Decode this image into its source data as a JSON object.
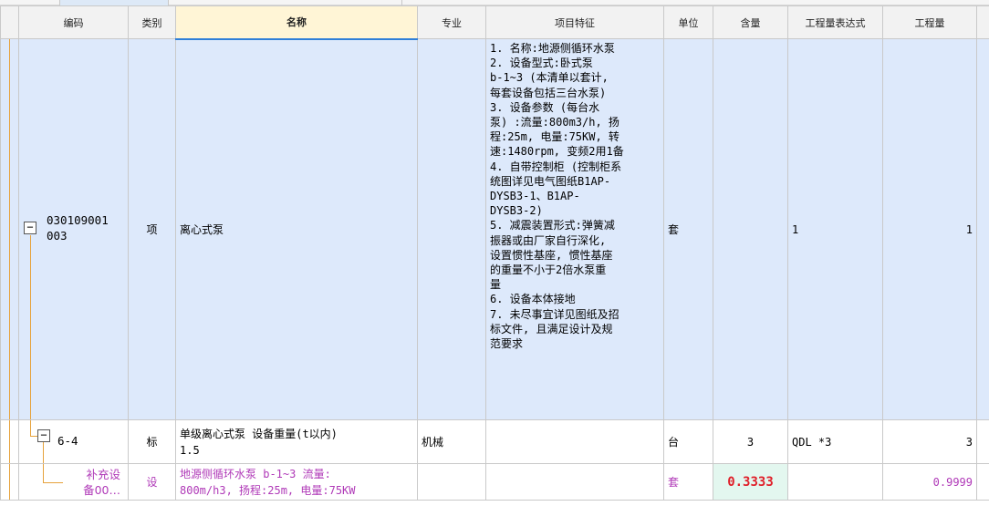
{
  "colors": {
    "header_bg": "#f2f2f2",
    "active_header_bg": "#fff5d6",
    "active_header_border": "#2f7fd8",
    "item_row_bg": "#dde9fb",
    "supplement_text": "#b03ab8",
    "quantity_highlight_bg": "#e3f7ef",
    "quantity_highlight_text": "#e0202a",
    "tree_line": "#e6a23c"
  },
  "columns": {
    "code": "编码",
    "category": "类别",
    "name": "名称",
    "specialty": "专业",
    "features": "项目特征",
    "unit": "单位",
    "content": "含量",
    "expression": "工程量表达式",
    "quantity": "工程量"
  },
  "rows": [
    {
      "code": "030109001003",
      "code_display": "030109001\n003",
      "toggle": "−",
      "category": "项",
      "name": "离心式泵",
      "specialty": "",
      "features": [
        "1. 名称:地源侧循环水泵",
        "2. 设备型式:卧式泵",
        "b-1~3 (本清单以套计,",
        "每套设备包括三台水泵)",
        "3. 设备参数 (每台水",
        "泵) :流量:800m3/h, 扬",
        "程:25m, 电量:75KW, 转",
        "速:1480rpm, 变频2用1备",
        "4. 自带控制柜 (控制柜系",
        "统图详见电气图纸B1AP-",
        "DYSB3-1、B1AP-",
        "DYSB3-2)",
        "5. 减震装置形式:弹簧减",
        "振器或由厂家自行深化,",
        "设置惯性基座, 惯性基座",
        "的重量不小于2倍水泵重",
        "量",
        "6. 设备本体接地",
        "7. 未尽事宜详见图纸及招",
        "标文件, 且满足设计及规",
        "范要求"
      ],
      "unit": "套",
      "content": "",
      "expression": "1",
      "quantity": "1"
    },
    {
      "code": "6-4",
      "toggle": "−",
      "category": "标",
      "name_line1": "单级离心式泵 设备重量(t以内)",
      "name_line2": "1.5",
      "specialty": "机械",
      "features": "",
      "unit": "台",
      "content": "3",
      "expression": "QDL *3",
      "quantity": "3"
    },
    {
      "code_line1": "补充设",
      "code_line2": "备00…",
      "category": "设",
      "name_line1": "地源侧循环水泵 b-1~3 流量:",
      "name_line2": "800m/h3, 扬程:25m, 电量:75KW",
      "specialty": "",
      "features": "",
      "unit": "套",
      "content": "0.3333",
      "expression": "",
      "quantity": "0.9999"
    }
  ]
}
